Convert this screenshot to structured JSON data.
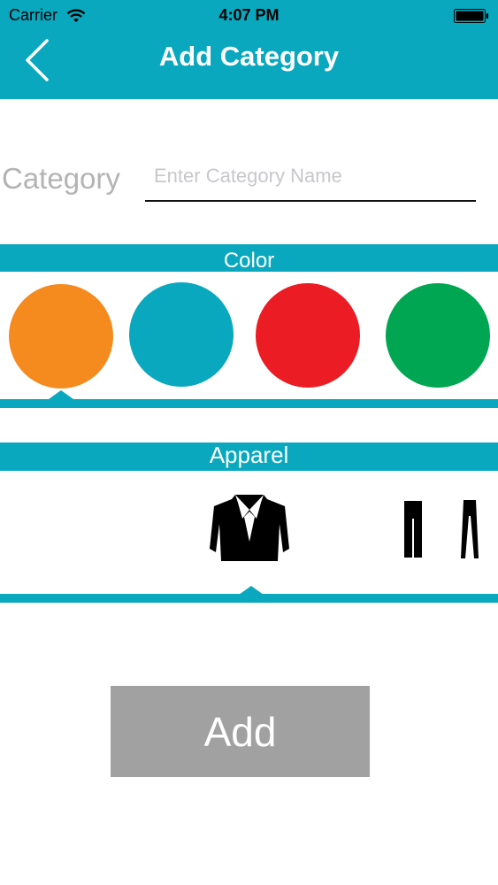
{
  "status_bar": {
    "carrier": "Carrier",
    "time": "4:07 PM"
  },
  "nav": {
    "title": "Add Category",
    "back_icon": "chevron-left-icon"
  },
  "category": {
    "label": "Category",
    "value": "",
    "placeholder": "Enter Category Name"
  },
  "color_section": {
    "title": "Color",
    "swatches": [
      "#f58b1f",
      "#0aa8be",
      "#ec1c24",
      "#00a651"
    ],
    "selected": "#f58b1f"
  },
  "apparel_section": {
    "title": "Apparel",
    "items": [
      "blazer-icon",
      "dress-icon",
      "pants-icon"
    ],
    "selected": "blazer-icon"
  },
  "add_button": {
    "label": "Add"
  },
  "colors": {
    "accent": "#0aa8be",
    "button": "#a1a1a1",
    "label": "#b3b3b3"
  }
}
